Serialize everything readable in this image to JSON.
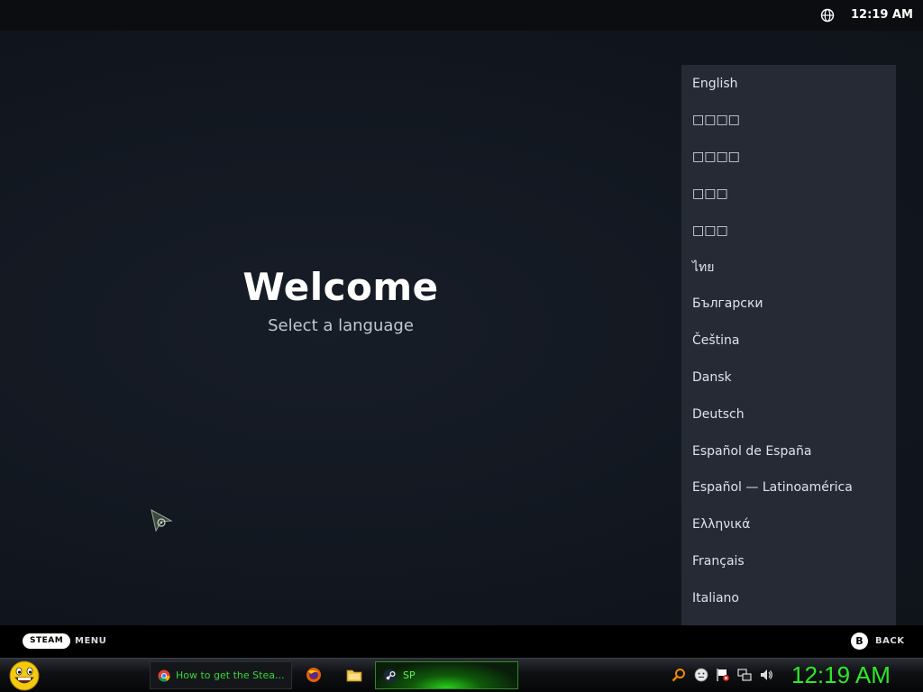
{
  "status_bar": {
    "clock": "12:19 AM"
  },
  "welcome": {
    "title": "Welcome",
    "subtitle": "Select a language"
  },
  "languages": [
    "English",
    "□□□□",
    "□□□□",
    "□□□",
    "□□□",
    "ไทย",
    "Български",
    "Čeština",
    "Dansk",
    "Deutsch",
    "Español de España",
    "Español — Latinoamérica",
    "Ελληνικά",
    "Français",
    "Italiano"
  ],
  "hint_bar": {
    "steam_label": "STEAM",
    "menu_label": "MENU",
    "b_label": "B",
    "back_label": "BACK"
  },
  "taskbar": {
    "tasks": [
      {
        "label": "How to get the Stea...",
        "icon": "chrome-icon"
      },
      {
        "label": "SP",
        "icon": "steam-icon"
      }
    ],
    "quick_launch": [
      "firefox-icon",
      "folder-icon"
    ],
    "tray_icons": [
      "search-icon",
      "messenger-icon",
      "flag-icon",
      "network-icon",
      "volume-icon"
    ],
    "clock": "12:19 AM"
  },
  "colors": {
    "accent_green": "#2ee82a",
    "panel": "#262a35",
    "background": "#121720"
  }
}
